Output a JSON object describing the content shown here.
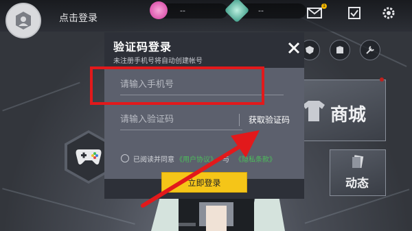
{
  "top": {
    "login_link": "点击登录",
    "currency1_value": "--",
    "currency2_value": "--",
    "mail_badge": "1"
  },
  "cards": {
    "shop_label": "商城",
    "dynamic_label": "动态"
  },
  "dialog": {
    "title": "验证码登录",
    "subtitle": "未注册手机号将自动创建帐号",
    "phone_placeholder": "请输入手机号",
    "code_placeholder": "请输入验证码",
    "get_code_label": "获取验证码",
    "agree_prefix": "已阅读并同意",
    "user_agreement": "《用户协议》",
    "and_text": "与",
    "privacy_policy": "《隐私条款》",
    "login_button": "立即登录"
  },
  "colors": {
    "dialog_bg": "#2d3038",
    "form_bg": "#5c606d",
    "login_button": "#f5c518",
    "link_green": "#4cbf5b",
    "annotation_red": "#e2191b"
  }
}
